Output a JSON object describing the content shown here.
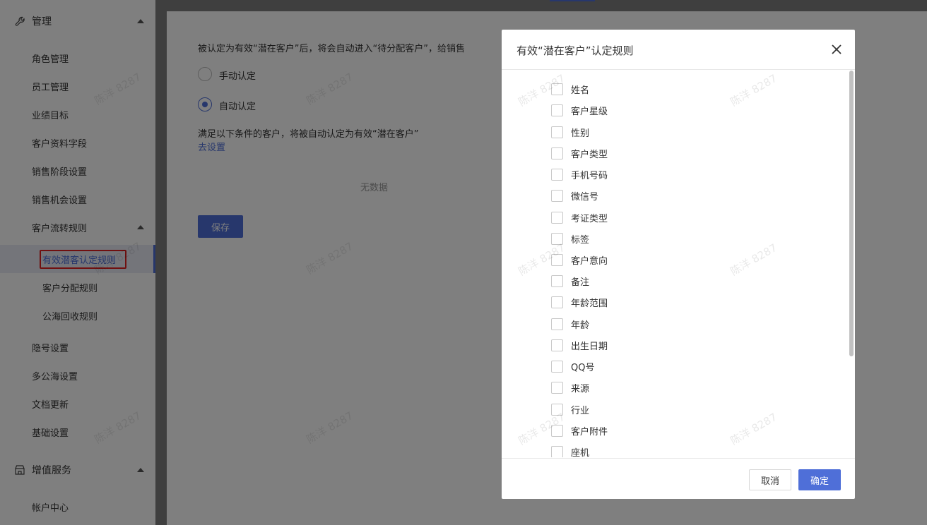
{
  "sidebar": {
    "group_manage": {
      "label": "管理",
      "icon": "wrench-icon"
    },
    "items": [
      {
        "label": "角色管理"
      },
      {
        "label": "员工管理"
      },
      {
        "label": "业绩目标"
      },
      {
        "label": "客户资料字段"
      },
      {
        "label": "销售阶段设置"
      },
      {
        "label": "销售机会设置"
      }
    ],
    "flow_rules": {
      "label": "客户流转规则"
    },
    "sub_items": [
      {
        "label": "有效潜客认定规则",
        "active": true
      },
      {
        "label": "客户分配规则"
      },
      {
        "label": "公海回收规则"
      }
    ],
    "items2": [
      {
        "label": "隐号设置"
      },
      {
        "label": "多公海设置"
      },
      {
        "label": "文档更新"
      },
      {
        "label": "基础设置"
      }
    ],
    "group_value": {
      "label": "增值服务",
      "icon": "shop-icon"
    },
    "account_center": {
      "label": "帐户中心"
    }
  },
  "main": {
    "description": "被认定为有效“潜在客户”后，将会自动进入“待分配客户”，给销售",
    "radio_manual": "手动认定",
    "radio_auto": "自动认定",
    "condition_text": "满足以下条件的客户，将被自动认定为有效“潜在客户”",
    "goto_settings": "去设置",
    "no_data": "无数据",
    "save": "保存"
  },
  "modal": {
    "title": "有效“潜在客户”认定规则",
    "fields": [
      "姓名",
      "客户星级",
      "性别",
      "客户类型",
      "手机号码",
      "微信号",
      "考证类型",
      "标签",
      "客户意向",
      "备注",
      "年龄范围",
      "年龄",
      "出生日期",
      "QQ号",
      "来源",
      "行业",
      "客户附件",
      "座机"
    ],
    "cancel": "取消",
    "confirm": "确定"
  },
  "watermark": "陈洋 8287",
  "colors": {
    "accent": "#4f6fd8",
    "highlight": "#e02020"
  }
}
